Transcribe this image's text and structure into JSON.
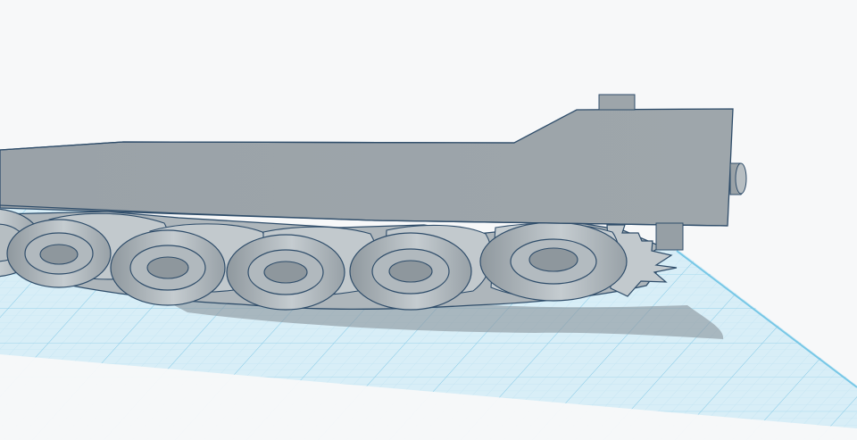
{
  "app": {
    "view": "3D design workspace",
    "text_visible": []
  },
  "colors": {
    "background": "#f7f8f9",
    "workplane_fill": "#d8eef7",
    "grid_minor": "#b9dff0",
    "grid_major": "#74c3e3",
    "model_gray": "#9ca3a8",
    "model_light": "#c4cbcf",
    "model_dark": "#6f787e",
    "edge": "#2f4d6a",
    "shadow": "#8b959c"
  },
  "icons": {
    "workplane": "grid-plane",
    "model": "tracked-vehicle-model",
    "shadow": "model-shadow"
  }
}
